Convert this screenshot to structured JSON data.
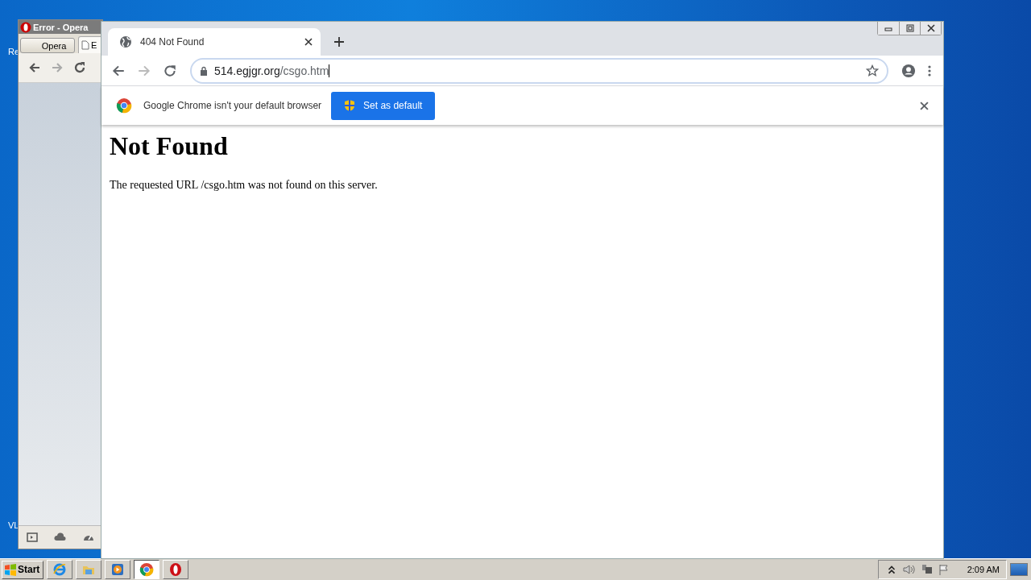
{
  "desktop": {
    "icon_labels": [
      "Re",
      "VL"
    ]
  },
  "opera_window": {
    "title": "Error - Opera",
    "menu_button": "Opera",
    "tab_label": "E"
  },
  "chrome_window": {
    "tabs": [
      {
        "title": "404 Not Found",
        "selected": true
      }
    ],
    "address_bar": {
      "host": "514.egjgr.org",
      "path": "/csgo.htm"
    },
    "infobar": {
      "message": "Google Chrome isn't your default browser",
      "button": "Set as default"
    },
    "page": {
      "heading": "Not Found",
      "message": "The requested URL /csgo.htm was not found on this server."
    }
  },
  "taskbar": {
    "start_label": "Start",
    "apps": [
      {
        "kind": "ie",
        "selected": false
      },
      {
        "kind": "folder",
        "selected": false
      },
      {
        "kind": "media",
        "selected": false
      },
      {
        "kind": "chrome",
        "selected": true
      },
      {
        "kind": "opera",
        "selected": false
      }
    ],
    "clock": "2:09 AM"
  }
}
